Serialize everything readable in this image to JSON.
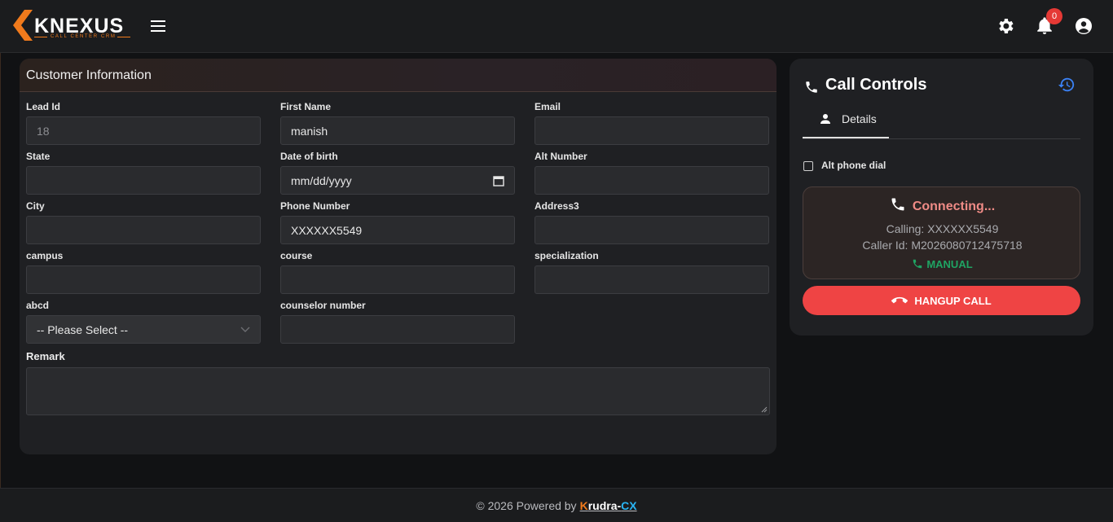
{
  "header": {
    "logo_text": "KNEXUS",
    "logo_sub": "CALL CENTER CRM",
    "notification_count": "0"
  },
  "customer": {
    "title": "Customer Information",
    "fields": [
      {
        "label": "Lead Id",
        "value": "18"
      },
      {
        "label": "First Name",
        "value": "manish"
      },
      {
        "label": "Email",
        "value": ""
      },
      {
        "label": "State",
        "value": ""
      },
      {
        "label": "Date of birth",
        "value": "mm/dd/yyyy"
      },
      {
        "label": "Alt Number",
        "value": ""
      },
      {
        "label": "City",
        "value": ""
      },
      {
        "label": "Phone Number",
        "value": "XXXXXX5549"
      },
      {
        "label": "Address3",
        "value": ""
      },
      {
        "label": "campus",
        "value": ""
      },
      {
        "label": "course",
        "value": ""
      },
      {
        "label": "specialization",
        "value": ""
      },
      {
        "label": "abcd",
        "value": "-- Please Select --"
      },
      {
        "label": "counselor number",
        "value": ""
      }
    ],
    "remark_label": "Remark",
    "remark_value": ""
  },
  "call_controls": {
    "title": "Call Controls",
    "tab_details": "Details",
    "alt_phone_label": "Alt phone dial",
    "status": "Connecting...",
    "calling": "Calling: XXXXXX5549",
    "caller_id": "Caller Id: M2026080712475718",
    "mode": "MANUAL",
    "hangup_label": "HANGUP CALL"
  },
  "footer": {
    "text": "© 2026 Powered by",
    "brand_part1": "K",
    "brand_part2": "rudra-",
    "brand_part3": "CX"
  },
  "colors": {
    "accent_orange": "#f07a1c",
    "status_connecting": "#ef8b86",
    "status_manual": "#1fa463",
    "hangup": "#ef4444",
    "history_icon": "#3b82f6",
    "brand_cx": "#29b6f6"
  }
}
